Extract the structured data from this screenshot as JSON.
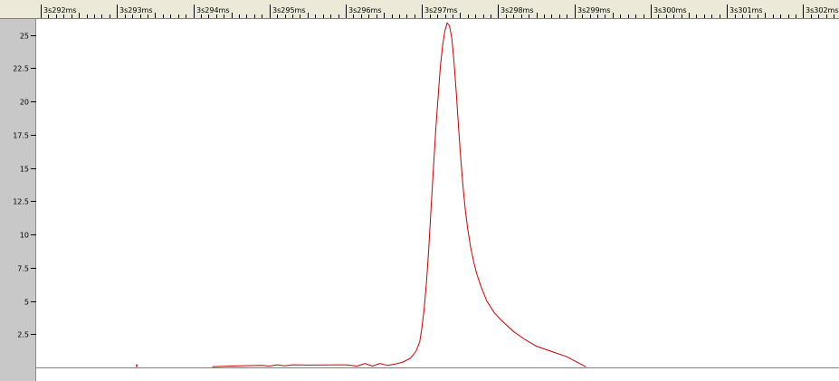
{
  "chart_data": {
    "type": "line",
    "title": "",
    "xlabel": "",
    "ylabel": "",
    "x_unit": "ms",
    "x_tick_labels": [
      "3s292ms",
      "3s293ms",
      "3s294ms",
      "3s295ms",
      "3s296ms",
      "3s297ms",
      "3s298ms",
      "3s299ms",
      "3s300ms",
      "3s301ms",
      "3s302ms"
    ],
    "x_tick_values": [
      3292,
      3293,
      3294,
      3295,
      3296,
      3297,
      3298,
      3299,
      3300,
      3301,
      3302
    ],
    "xlim": [
      3291.94,
      3302.47
    ],
    "y_tick_labels": [
      "2.5",
      "5",
      "7.5",
      "10",
      "12.5",
      "15",
      "17.5",
      "20",
      "22.5",
      "25"
    ],
    "y_tick_values": [
      2.5,
      5,
      7.5,
      10,
      12.5,
      15,
      17.5,
      20,
      22.5,
      25
    ],
    "ylim": [
      0,
      26.2
    ],
    "grid": false,
    "series": [
      {
        "color": "#cc0000",
        "points": [
          [
            3293.25,
            0.05
          ],
          [
            3293.26,
            0.2
          ],
          [
            3293.27,
            0.05
          ],
          [
            3294.25,
            0.05
          ],
          [
            3294.6,
            0.12
          ],
          [
            3294.9,
            0.15
          ],
          [
            3295.0,
            0.1
          ],
          [
            3295.1,
            0.2
          ],
          [
            3295.2,
            0.12
          ],
          [
            3295.3,
            0.2
          ],
          [
            3295.5,
            0.18
          ],
          [
            3296.0,
            0.2
          ],
          [
            3296.15,
            0.1
          ],
          [
            3296.25,
            0.3
          ],
          [
            3296.35,
            0.1
          ],
          [
            3296.45,
            0.3
          ],
          [
            3296.55,
            0.15
          ],
          [
            3296.65,
            0.25
          ],
          [
            3296.75,
            0.4
          ],
          [
            3296.85,
            0.7
          ],
          [
            3296.92,
            1.2
          ],
          [
            3296.97,
            1.9
          ],
          [
            3297.0,
            3.0
          ],
          [
            3297.03,
            4.5
          ],
          [
            3297.06,
            6.5
          ],
          [
            3297.09,
            9.0
          ],
          [
            3297.12,
            12.0
          ],
          [
            3297.15,
            15.0
          ],
          [
            3297.18,
            17.8
          ],
          [
            3297.21,
            20.2
          ],
          [
            3297.24,
            22.5
          ],
          [
            3297.27,
            24.2
          ],
          [
            3297.3,
            25.3
          ],
          [
            3297.33,
            25.9
          ],
          [
            3297.36,
            25.7
          ],
          [
            3297.39,
            24.8
          ],
          [
            3297.42,
            23.0
          ],
          [
            3297.45,
            20.7
          ],
          [
            3297.48,
            18.0
          ],
          [
            3297.51,
            15.6
          ],
          [
            3297.54,
            13.5
          ],
          [
            3297.57,
            11.8
          ],
          [
            3297.6,
            10.4
          ],
          [
            3297.64,
            9.0
          ],
          [
            3297.68,
            7.9
          ],
          [
            3297.72,
            7.0
          ],
          [
            3297.78,
            6.0
          ],
          [
            3297.85,
            5.0
          ],
          [
            3297.95,
            4.1
          ],
          [
            3298.05,
            3.5
          ],
          [
            3298.2,
            2.7
          ],
          [
            3298.35,
            2.1
          ],
          [
            3298.5,
            1.6
          ],
          [
            3298.7,
            1.2
          ],
          [
            3298.9,
            0.8
          ],
          [
            3299.0,
            0.5
          ],
          [
            3299.1,
            0.2
          ],
          [
            3299.15,
            0.05
          ]
        ]
      }
    ]
  },
  "colors": {
    "trace": "#cc0000",
    "ruler_bg": "#ece9d8",
    "gutter_bg": "#c8c8c8",
    "baseline": "#808080"
  }
}
